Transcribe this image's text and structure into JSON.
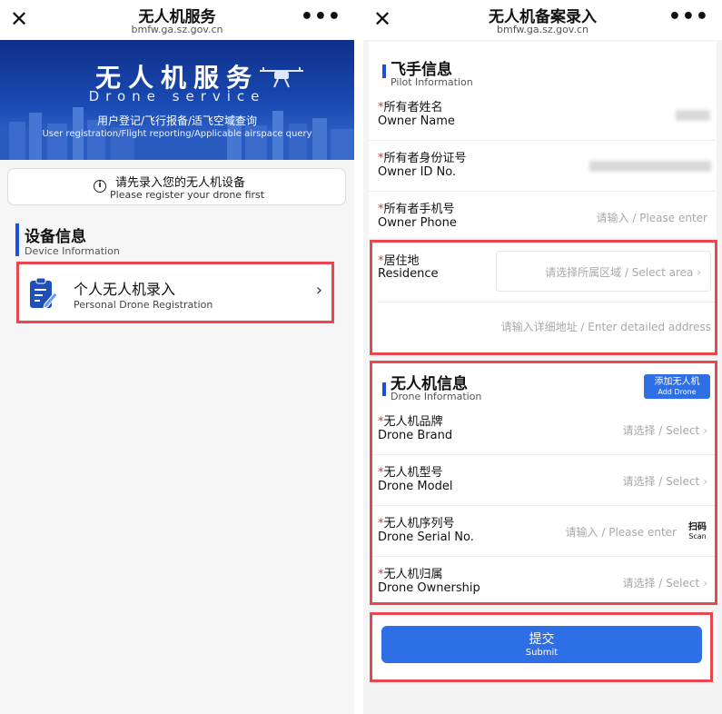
{
  "left": {
    "topbar": {
      "title": "无人机服务",
      "url": "bmfw.ga.sz.gov.cn"
    },
    "banner": {
      "title": "无人机服务",
      "subtitle_en": "Drone service",
      "line_cn": "用户登记/飞行报备/适飞空域查询",
      "line_en": "User registration/Flight reporting/Applicable airspace query"
    },
    "notice": {
      "cn": "请先录入您的无人机设备",
      "en": "Please register your drone first"
    },
    "section": {
      "cn": "设备信息",
      "en": "Device Information"
    },
    "registration": {
      "cn": "个人无人机录入",
      "en": "Personal Drone Registration"
    }
  },
  "right": {
    "topbar": {
      "title": "无人机备案录入",
      "url": "bmfw.ga.sz.gov.cn"
    },
    "pilot_section": {
      "cn": "飞手信息",
      "en": "Pilot Information"
    },
    "owner_name": {
      "cn": "所有者姓名",
      "en": "Owner Name"
    },
    "owner_id": {
      "cn": "所有者身份证号",
      "en": "Owner ID No."
    },
    "owner_phone": {
      "cn": "所有者手机号",
      "en": "Owner Phone",
      "placeholder": "请输入 / Please enter"
    },
    "residence": {
      "cn": "居住地",
      "en": "Residence",
      "area_placeholder": "请选择所属区域 / Select area",
      "address_placeholder": "请输入详细地址 / Enter detailed address"
    },
    "drone_section": {
      "cn": "无人机信息",
      "en": "Drone Information",
      "add_cn": "添加无人机",
      "add_en": "Add Drone"
    },
    "drone_brand": {
      "cn": "无人机品牌",
      "en": "Drone Brand",
      "placeholder": "请选择 / Select"
    },
    "drone_model": {
      "cn": "无人机型号",
      "en": "Drone Model",
      "placeholder": "请选择 / Select"
    },
    "drone_serial": {
      "cn": "无人机序列号",
      "en": "Drone Serial No.",
      "placeholder": "请输入 / Please enter",
      "scan_cn": "扫码",
      "scan_en": "Scan"
    },
    "drone_ownership": {
      "cn": "无人机归属",
      "en": "Drone Ownership",
      "placeholder": "请选择 / Select"
    },
    "submit": {
      "cn": "提交",
      "en": "Submit"
    }
  },
  "symbols": {
    "required": "*",
    "chevron": "›",
    "close": "✕",
    "more": "•••",
    "info": "i"
  },
  "colors": {
    "accent": "#2f6fe6",
    "highlight": "#e8474f",
    "banner": "#1a4bb4",
    "required": "#e03030"
  }
}
